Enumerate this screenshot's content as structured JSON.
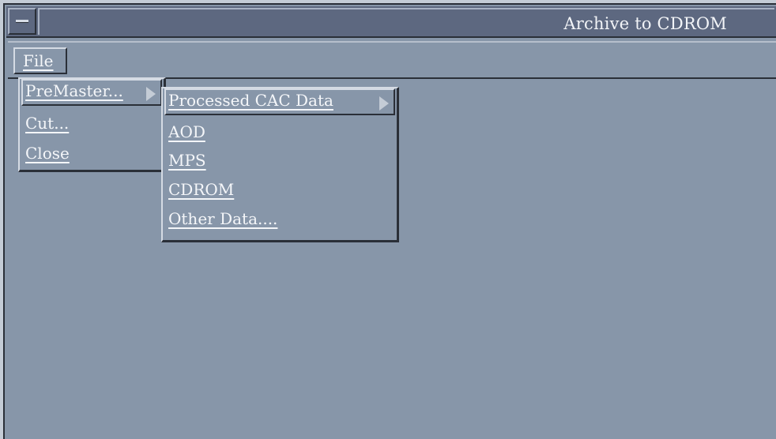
{
  "window": {
    "title": "Archive to CDROM"
  },
  "menubar": {
    "file_label": "File"
  },
  "file_menu": {
    "items": [
      {
        "label": "PreMaster...",
        "has_submenu": true
      },
      {
        "label": "Cut..."
      },
      {
        "label": "Close"
      }
    ]
  },
  "premaster_submenu": {
    "items": [
      {
        "label": "Processed CAC Data",
        "has_submenu": true
      },
      {
        "label": "AOD"
      },
      {
        "label": "MPS"
      },
      {
        "label": "CDROM"
      },
      {
        "label": "Other Data...."
      }
    ]
  },
  "colors": {
    "background": "#8796a9",
    "titlebar": "#5d6880",
    "text": "#f4f6f9"
  },
  "icons": {
    "window_menu": "window-menu-icon",
    "cascade": "cascade-arrow-icon"
  }
}
